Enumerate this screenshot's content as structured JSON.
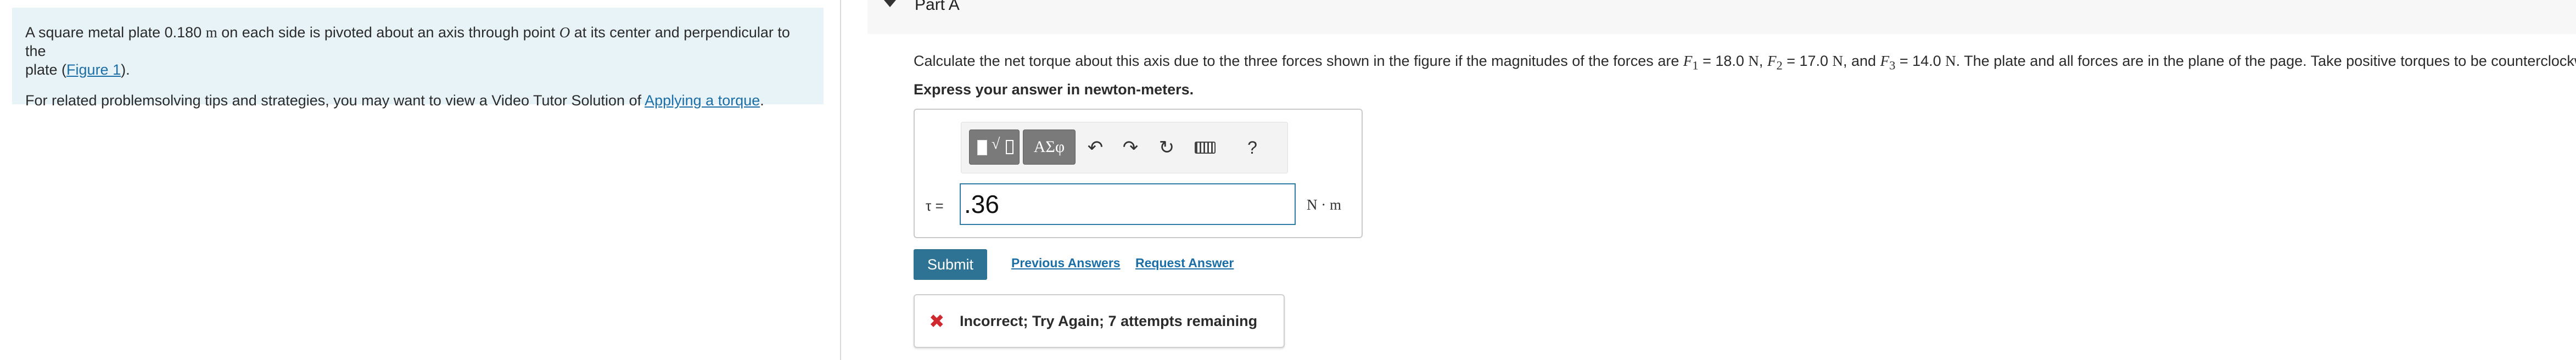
{
  "intro": {
    "line1_pre": "A square metal plate 0.180 ",
    "line1_unit": "m",
    "line1_mid": " on each side is pivoted about an axis through point ",
    "line1_point": "O",
    "line1_post": " at its center and perpendicular to the",
    "line2_pre": "plate (",
    "figure_link": "Figure 1",
    "line2_post": ").",
    "tips_pre": "For related problemsolving tips and strategies, you may want to view a Video Tutor Solution of ",
    "tips_link": "Applying a torque",
    "tips_post": "."
  },
  "part": {
    "title": "Part A"
  },
  "question": {
    "p1": "Calculate the net torque about this axis due to the three forces shown in the figure if the magnitudes of the forces are ",
    "f1_sym": "F",
    "f1_sub": "1",
    "f1_val": " = 18.0 ",
    "unit_n": "N",
    "sep1": ", ",
    "f2_sym": "F",
    "f2_sub": "2",
    "f2_val": " = 17.0 ",
    "sep2": ", and ",
    "f3_sym": "F",
    "f3_sub": "3",
    "f3_val": " = 14.0 ",
    "p2": ". The plate and all forces are in the plane of the page. Take positive torques to be counterclockwise.",
    "instruction": "Express your answer in newton-meters."
  },
  "answer": {
    "label": "τ =",
    "value": ".36",
    "units": "N · m"
  },
  "toolbar": {
    "templates_radical": "√",
    "symbols_label": "ΑΣφ",
    "undo_glyph": "↶",
    "redo_glyph": "↷",
    "reset_glyph": "↻",
    "help_label": "?",
    "icons": [
      "templates-icon",
      "symbols-icon",
      "undo-icon",
      "redo-icon",
      "reset-icon",
      "keyboard-icon",
      "help-icon"
    ]
  },
  "actions": {
    "submit": "Submit",
    "previous_answers": "Previous Answers",
    "request_answer": "Request Answer"
  },
  "feedback": {
    "icon": "✖",
    "text": "Incorrect; Try Again; 7 attempts remaining"
  },
  "colors": {
    "intro_bg": "#e8f3f8",
    "accent": "#2f7394",
    "link": "#1b6fa6",
    "error": "#d0282f",
    "input_border": "#2e7ba5"
  }
}
